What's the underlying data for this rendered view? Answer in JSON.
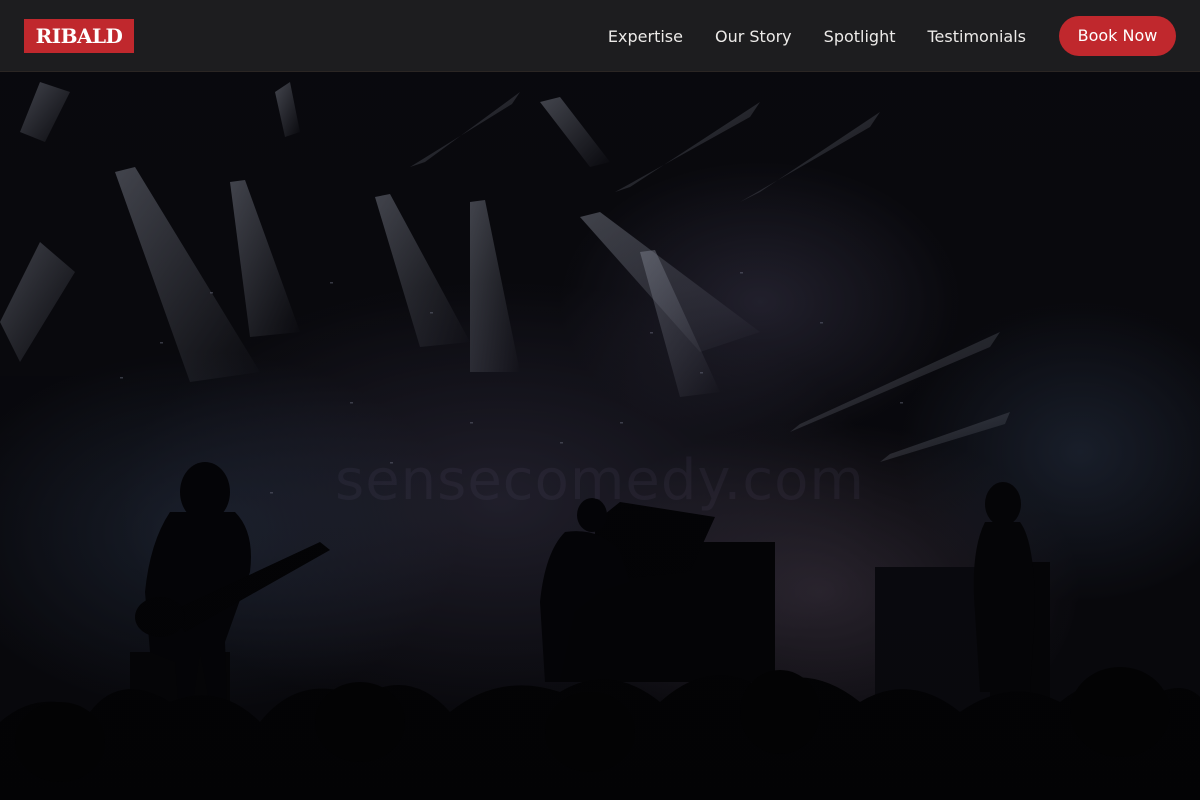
{
  "brand": {
    "logo_text": "RIBALD",
    "accent_color": "#c0282d",
    "nav_bg": "#1d1d1f"
  },
  "nav": {
    "links": [
      {
        "label": "Expertise"
      },
      {
        "label": "Our Story"
      },
      {
        "label": "Spotlight"
      },
      {
        "label": "Testimonials"
      }
    ],
    "cta_label": "Book Now"
  },
  "hero": {
    "image_subject": "concert-stage",
    "watermark_text": "sensecomedy.com"
  }
}
